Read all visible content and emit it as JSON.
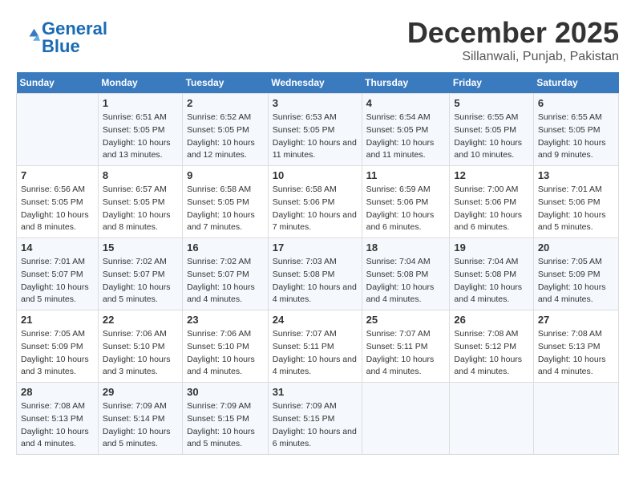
{
  "logo": {
    "text_general": "General",
    "text_blue": "Blue"
  },
  "title": "December 2025",
  "subtitle": "Sillanwali, Punjab, Pakistan",
  "days_of_week": [
    "Sunday",
    "Monday",
    "Tuesday",
    "Wednesday",
    "Thursday",
    "Friday",
    "Saturday"
  ],
  "weeks": [
    [
      {
        "day": "",
        "sunrise": "",
        "sunset": "",
        "daylight": ""
      },
      {
        "day": "1",
        "sunrise": "Sunrise: 6:51 AM",
        "sunset": "Sunset: 5:05 PM",
        "daylight": "Daylight: 10 hours and 13 minutes."
      },
      {
        "day": "2",
        "sunrise": "Sunrise: 6:52 AM",
        "sunset": "Sunset: 5:05 PM",
        "daylight": "Daylight: 10 hours and 12 minutes."
      },
      {
        "day": "3",
        "sunrise": "Sunrise: 6:53 AM",
        "sunset": "Sunset: 5:05 PM",
        "daylight": "Daylight: 10 hours and 11 minutes."
      },
      {
        "day": "4",
        "sunrise": "Sunrise: 6:54 AM",
        "sunset": "Sunset: 5:05 PM",
        "daylight": "Daylight: 10 hours and 11 minutes."
      },
      {
        "day": "5",
        "sunrise": "Sunrise: 6:55 AM",
        "sunset": "Sunset: 5:05 PM",
        "daylight": "Daylight: 10 hours and 10 minutes."
      },
      {
        "day": "6",
        "sunrise": "Sunrise: 6:55 AM",
        "sunset": "Sunset: 5:05 PM",
        "daylight": "Daylight: 10 hours and 9 minutes."
      }
    ],
    [
      {
        "day": "7",
        "sunrise": "Sunrise: 6:56 AM",
        "sunset": "Sunset: 5:05 PM",
        "daylight": "Daylight: 10 hours and 8 minutes."
      },
      {
        "day": "8",
        "sunrise": "Sunrise: 6:57 AM",
        "sunset": "Sunset: 5:05 PM",
        "daylight": "Daylight: 10 hours and 8 minutes."
      },
      {
        "day": "9",
        "sunrise": "Sunrise: 6:58 AM",
        "sunset": "Sunset: 5:05 PM",
        "daylight": "Daylight: 10 hours and 7 minutes."
      },
      {
        "day": "10",
        "sunrise": "Sunrise: 6:58 AM",
        "sunset": "Sunset: 5:06 PM",
        "daylight": "Daylight: 10 hours and 7 minutes."
      },
      {
        "day": "11",
        "sunrise": "Sunrise: 6:59 AM",
        "sunset": "Sunset: 5:06 PM",
        "daylight": "Daylight: 10 hours and 6 minutes."
      },
      {
        "day": "12",
        "sunrise": "Sunrise: 7:00 AM",
        "sunset": "Sunset: 5:06 PM",
        "daylight": "Daylight: 10 hours and 6 minutes."
      },
      {
        "day": "13",
        "sunrise": "Sunrise: 7:01 AM",
        "sunset": "Sunset: 5:06 PM",
        "daylight": "Daylight: 10 hours and 5 minutes."
      }
    ],
    [
      {
        "day": "14",
        "sunrise": "Sunrise: 7:01 AM",
        "sunset": "Sunset: 5:07 PM",
        "daylight": "Daylight: 10 hours and 5 minutes."
      },
      {
        "day": "15",
        "sunrise": "Sunrise: 7:02 AM",
        "sunset": "Sunset: 5:07 PM",
        "daylight": "Daylight: 10 hours and 5 minutes."
      },
      {
        "day": "16",
        "sunrise": "Sunrise: 7:02 AM",
        "sunset": "Sunset: 5:07 PM",
        "daylight": "Daylight: 10 hours and 4 minutes."
      },
      {
        "day": "17",
        "sunrise": "Sunrise: 7:03 AM",
        "sunset": "Sunset: 5:08 PM",
        "daylight": "Daylight: 10 hours and 4 minutes."
      },
      {
        "day": "18",
        "sunrise": "Sunrise: 7:04 AM",
        "sunset": "Sunset: 5:08 PM",
        "daylight": "Daylight: 10 hours and 4 minutes."
      },
      {
        "day": "19",
        "sunrise": "Sunrise: 7:04 AM",
        "sunset": "Sunset: 5:08 PM",
        "daylight": "Daylight: 10 hours and 4 minutes."
      },
      {
        "day": "20",
        "sunrise": "Sunrise: 7:05 AM",
        "sunset": "Sunset: 5:09 PM",
        "daylight": "Daylight: 10 hours and 4 minutes."
      }
    ],
    [
      {
        "day": "21",
        "sunrise": "Sunrise: 7:05 AM",
        "sunset": "Sunset: 5:09 PM",
        "daylight": "Daylight: 10 hours and 3 minutes."
      },
      {
        "day": "22",
        "sunrise": "Sunrise: 7:06 AM",
        "sunset": "Sunset: 5:10 PM",
        "daylight": "Daylight: 10 hours and 3 minutes."
      },
      {
        "day": "23",
        "sunrise": "Sunrise: 7:06 AM",
        "sunset": "Sunset: 5:10 PM",
        "daylight": "Daylight: 10 hours and 4 minutes."
      },
      {
        "day": "24",
        "sunrise": "Sunrise: 7:07 AM",
        "sunset": "Sunset: 5:11 PM",
        "daylight": "Daylight: 10 hours and 4 minutes."
      },
      {
        "day": "25",
        "sunrise": "Sunrise: 7:07 AM",
        "sunset": "Sunset: 5:11 PM",
        "daylight": "Daylight: 10 hours and 4 minutes."
      },
      {
        "day": "26",
        "sunrise": "Sunrise: 7:08 AM",
        "sunset": "Sunset: 5:12 PM",
        "daylight": "Daylight: 10 hours and 4 minutes."
      },
      {
        "day": "27",
        "sunrise": "Sunrise: 7:08 AM",
        "sunset": "Sunset: 5:13 PM",
        "daylight": "Daylight: 10 hours and 4 minutes."
      }
    ],
    [
      {
        "day": "28",
        "sunrise": "Sunrise: 7:08 AM",
        "sunset": "Sunset: 5:13 PM",
        "daylight": "Daylight: 10 hours and 4 minutes."
      },
      {
        "day": "29",
        "sunrise": "Sunrise: 7:09 AM",
        "sunset": "Sunset: 5:14 PM",
        "daylight": "Daylight: 10 hours and 5 minutes."
      },
      {
        "day": "30",
        "sunrise": "Sunrise: 7:09 AM",
        "sunset": "Sunset: 5:15 PM",
        "daylight": "Daylight: 10 hours and 5 minutes."
      },
      {
        "day": "31",
        "sunrise": "Sunrise: 7:09 AM",
        "sunset": "Sunset: 5:15 PM",
        "daylight": "Daylight: 10 hours and 6 minutes."
      },
      {
        "day": "",
        "sunrise": "",
        "sunset": "",
        "daylight": ""
      },
      {
        "day": "",
        "sunrise": "",
        "sunset": "",
        "daylight": ""
      },
      {
        "day": "",
        "sunrise": "",
        "sunset": "",
        "daylight": ""
      }
    ]
  ]
}
